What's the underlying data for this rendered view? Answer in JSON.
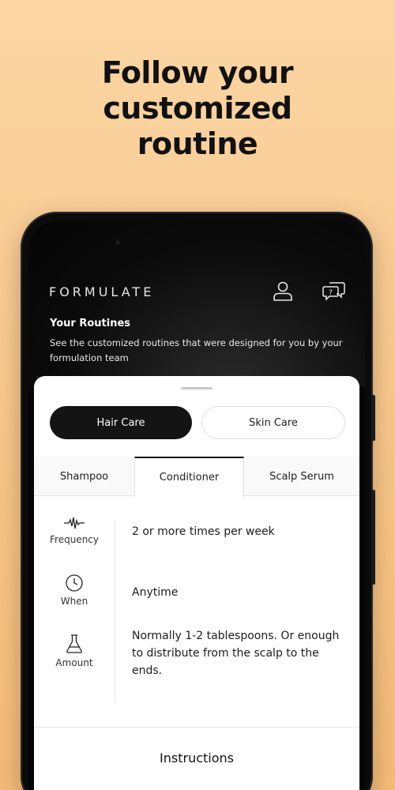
{
  "headline": {
    "line1": "Follow your",
    "line2": "customized",
    "line3": "routine"
  },
  "app": {
    "brand": "FORMULATE",
    "account_icon": "user-icon",
    "support_icon": "chat-question-icon"
  },
  "routines": {
    "title": "Your Routines",
    "subtitle": "See the customized routines that were designed for you by your formulation team"
  },
  "segments": [
    {
      "label": "Hair Care",
      "active": true
    },
    {
      "label": "Skin Care",
      "active": false
    }
  ],
  "tabs": [
    {
      "label": "Shampoo",
      "active": false
    },
    {
      "label": "Conditioner",
      "active": true
    },
    {
      "label": "Scalp Serum",
      "active": false
    }
  ],
  "details": [
    {
      "icon": "pulse-icon",
      "label": "Frequency",
      "value": "2 or more times per week"
    },
    {
      "icon": "clock-icon",
      "label": "When",
      "value": "Anytime"
    },
    {
      "icon": "flask-icon",
      "label": "Amount",
      "value": "Normally 1-2 tablespoons. Or enough to distribute from the scalp to the ends."
    }
  ],
  "instructions_label": "Instructions",
  "colors": {
    "background_top": "#fbd6a4",
    "background_bottom": "#f5bb79",
    "phone": "#0b0b0b",
    "active_segment": "#141414"
  }
}
